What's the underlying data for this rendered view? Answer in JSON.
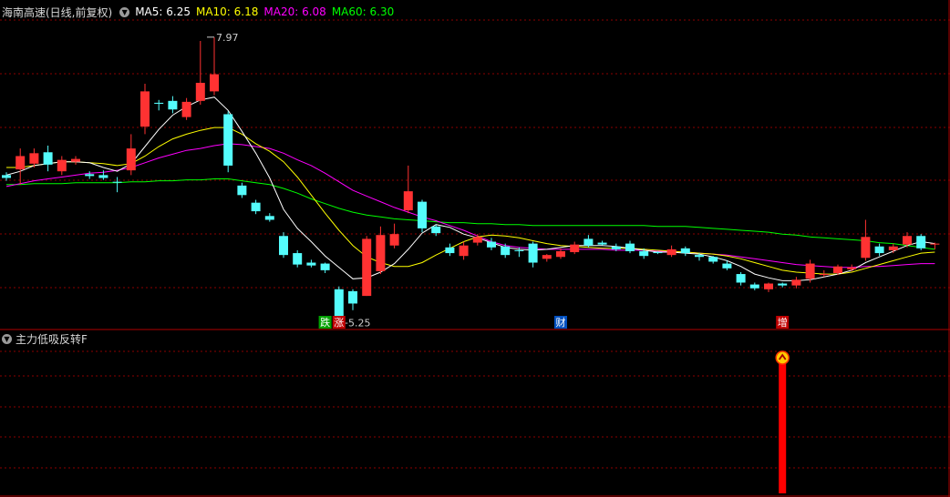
{
  "header": {
    "title": "海南高速(日线,前复权)",
    "indicators": [
      {
        "label": "MA5: 6.25",
        "color": "#ffffff"
      },
      {
        "label": "MA10: 6.18",
        "color": "#ffff00"
      },
      {
        "label": "MA20: 6.08",
        "color": "#ff00ff"
      },
      {
        "label": "MA60: 6.30",
        "color": "#00ff00"
      }
    ]
  },
  "sub_panel": {
    "title": "主力低吸反转F"
  },
  "colors": {
    "up": "#ff3232",
    "down": "#54fcfc",
    "grid": "#8b0000",
    "border": "#b00000"
  },
  "chart_data": {
    "type": "candlestick",
    "price_range": [
      5.05,
      8.15
    ],
    "high_label": "7.97",
    "low_label": "5.25",
    "candles": [
      [
        6.52,
        6.49,
        6.55,
        6.46
      ],
      [
        6.58,
        6.72,
        6.8,
        6.42
      ],
      [
        6.64,
        6.75,
        6.8,
        6.6
      ],
      [
        6.76,
        6.63,
        6.83,
        6.56
      ],
      [
        6.56,
        6.68,
        6.72,
        6.52
      ],
      [
        6.66,
        6.69,
        6.72,
        6.63
      ],
      [
        6.53,
        6.51,
        6.56,
        6.48
      ],
      [
        6.52,
        6.49,
        6.57,
        6.47
      ],
      [
        6.45,
        6.44,
        6.5,
        6.34
      ],
      [
        6.57,
        6.8,
        6.95,
        6.52
      ],
      [
        7.03,
        7.4,
        7.48,
        6.95
      ],
      [
        7.28,
        7.27,
        7.31,
        7.2
      ],
      [
        7.3,
        7.21,
        7.35,
        7.17
      ],
      [
        7.13,
        7.29,
        7.33,
        7.1
      ],
      [
        7.3,
        7.49,
        7.93,
        7.26
      ],
      [
        7.4,
        7.58,
        7.97,
        7.36
      ],
      [
        7.16,
        6.62,
        7.19,
        6.55
      ],
      [
        6.41,
        6.31,
        6.44,
        6.28
      ],
      [
        6.23,
        6.14,
        6.26,
        6.11
      ],
      [
        6.09,
        6.05,
        6.12,
        6.03
      ],
      [
        5.88,
        5.68,
        5.92,
        5.65
      ],
      [
        5.7,
        5.58,
        5.73,
        5.55
      ],
      [
        5.6,
        5.57,
        5.63,
        5.55
      ],
      [
        5.59,
        5.52,
        5.6,
        5.49
      ],
      [
        5.32,
        5.0,
        5.35,
        4.97
      ],
      [
        5.3,
        5.17,
        5.32,
        5.1
      ],
      [
        5.25,
        5.85,
        5.88,
        5.25
      ],
      [
        5.51,
        5.89,
        5.98,
        5.48
      ],
      [
        5.78,
        5.9,
        6.01,
        5.75
      ],
      [
        6.15,
        6.35,
        6.62,
        6.12
      ],
      [
        6.24,
        5.96,
        6.26,
        5.92
      ],
      [
        5.98,
        5.91,
        6.0,
        5.88
      ],
      [
        5.76,
        5.7,
        5.8,
        5.67
      ],
      [
        5.67,
        5.78,
        5.82,
        5.63
      ],
      [
        5.81,
        5.87,
        5.9,
        5.78
      ],
      [
        5.82,
        5.76,
        5.86,
        5.73
      ],
      [
        5.77,
        5.68,
        5.8,
        5.65
      ],
      [
        5.73,
        5.72,
        5.76,
        5.66
      ],
      [
        5.8,
        5.6,
        5.82,
        5.55
      ],
      [
        5.64,
        5.68,
        5.69,
        5.61
      ],
      [
        5.66,
        5.72,
        5.75,
        5.64
      ],
      [
        5.71,
        5.79,
        5.82,
        5.69
      ],
      [
        5.85,
        5.78,
        5.89,
        5.76
      ],
      [
        5.81,
        5.79,
        5.83,
        5.78
      ],
      [
        5.77,
        5.74,
        5.8,
        5.72
      ],
      [
        5.8,
        5.72,
        5.83,
        5.7
      ],
      [
        5.72,
        5.67,
        5.75,
        5.64
      ],
      [
        5.71,
        5.7,
        5.72,
        5.69
      ],
      [
        5.68,
        5.74,
        5.78,
        5.66
      ],
      [
        5.75,
        5.7,
        5.77,
        5.67
      ],
      [
        5.68,
        5.66,
        5.7,
        5.62
      ],
      [
        5.66,
        5.61,
        5.67,
        5.59
      ],
      [
        5.59,
        5.54,
        5.62,
        5.52
      ],
      [
        5.48,
        5.39,
        5.5,
        5.36
      ],
      [
        5.37,
        5.33,
        5.39,
        5.31
      ],
      [
        5.32,
        5.38,
        5.39,
        5.29
      ],
      [
        5.38,
        5.36,
        5.39,
        5.34
      ],
      [
        5.36,
        5.42,
        5.45,
        5.33
      ],
      [
        5.43,
        5.59,
        5.63,
        5.39
      ],
      [
        5.47,
        5.48,
        5.52,
        5.45
      ],
      [
        5.49,
        5.56,
        5.58,
        5.47
      ],
      [
        5.53,
        5.55,
        5.58,
        5.51
      ],
      [
        5.65,
        5.87,
        6.05,
        5.62
      ],
      [
        5.77,
        5.7,
        5.8,
        5.67
      ],
      [
        5.73,
        5.77,
        5.8,
        5.7
      ],
      [
        5.79,
        5.88,
        5.92,
        5.76
      ],
      [
        5.88,
        5.75,
        5.9,
        5.73
      ],
      [
        5.79,
        5.8,
        5.81,
        5.74
      ]
    ],
    "ma5": [
      6.52,
      6.56,
      6.62,
      6.64,
      6.66,
      6.66,
      6.65,
      6.6,
      6.56,
      6.64,
      6.82,
      7.0,
      7.15,
      7.24,
      7.31,
      7.34,
      7.2,
      6.98,
      6.75,
      6.49,
      6.16,
      5.96,
      5.82,
      5.67,
      5.55,
      5.43,
      5.44,
      5.5,
      5.59,
      5.74,
      5.91,
      6.0,
      5.97,
      5.9,
      5.86,
      5.81,
      5.76,
      5.74,
      5.73,
      5.74,
      5.76,
      5.78,
      5.78,
      5.78,
      5.77,
      5.75,
      5.73,
      5.71,
      5.71,
      5.7,
      5.69,
      5.66,
      5.62,
      5.56,
      5.48,
      5.44,
      5.41,
      5.41,
      5.42,
      5.45,
      5.48,
      5.52,
      5.6,
      5.66,
      5.72,
      5.78,
      5.82,
      5.8
    ],
    "ma10": [
      6.6,
      6.6,
      6.62,
      6.64,
      6.66,
      6.66,
      6.65,
      6.64,
      6.62,
      6.64,
      6.72,
      6.82,
      6.9,
      6.95,
      6.99,
      7.02,
      7.02,
      6.95,
      6.85,
      6.77,
      6.66,
      6.5,
      6.31,
      6.12,
      5.94,
      5.78,
      5.66,
      5.6,
      5.56,
      5.56,
      5.6,
      5.68,
      5.75,
      5.82,
      5.87,
      5.89,
      5.88,
      5.86,
      5.83,
      5.8,
      5.78,
      5.77,
      5.76,
      5.75,
      5.75,
      5.75,
      5.74,
      5.73,
      5.72,
      5.71,
      5.7,
      5.69,
      5.67,
      5.64,
      5.6,
      5.56,
      5.52,
      5.5,
      5.49,
      5.48,
      5.48,
      5.5,
      5.54,
      5.58,
      5.62,
      5.66,
      5.7,
      5.71
    ],
    "ma20": [
      6.4,
      6.43,
      6.46,
      6.48,
      6.5,
      6.52,
      6.54,
      6.55,
      6.57,
      6.6,
      6.65,
      6.7,
      6.74,
      6.78,
      6.8,
      6.83,
      6.85,
      6.84,
      6.82,
      6.8,
      6.75,
      6.68,
      6.62,
      6.54,
      6.45,
      6.36,
      6.3,
      6.24,
      6.18,
      6.13,
      6.08,
      6.04,
      5.99,
      5.94,
      5.88,
      5.82,
      5.78,
      5.76,
      5.75,
      5.74,
      5.74,
      5.74,
      5.74,
      5.74,
      5.73,
      5.73,
      5.73,
      5.72,
      5.72,
      5.71,
      5.7,
      5.69,
      5.68,
      5.66,
      5.64,
      5.62,
      5.6,
      5.58,
      5.57,
      5.56,
      5.55,
      5.55,
      5.56,
      5.56,
      5.57,
      5.58,
      5.59,
      5.59
    ],
    "ma60": [
      6.42,
      6.42,
      6.43,
      6.43,
      6.43,
      6.44,
      6.44,
      6.44,
      6.44,
      6.45,
      6.45,
      6.46,
      6.46,
      6.47,
      6.47,
      6.48,
      6.48,
      6.46,
      6.44,
      6.42,
      6.38,
      6.33,
      6.27,
      6.22,
      6.17,
      6.13,
      6.1,
      6.08,
      6.06,
      6.05,
      6.04,
      6.03,
      6.02,
      6.02,
      6.01,
      6.01,
      6.0,
      6.0,
      5.99,
      5.99,
      5.99,
      5.99,
      5.99,
      5.99,
      5.99,
      5.99,
      5.99,
      5.98,
      5.98,
      5.98,
      5.97,
      5.96,
      5.95,
      5.94,
      5.93,
      5.92,
      5.9,
      5.89,
      5.87,
      5.86,
      5.85,
      5.84,
      5.83,
      5.81,
      5.8,
      5.78,
      5.76,
      5.74
    ],
    "signals": [
      {
        "index": 23,
        "label": "跌",
        "bg": "#00a000"
      },
      {
        "index": 24,
        "label": "涨",
        "bg": "#c00000"
      },
      {
        "index": 40,
        "label": "财",
        "bg": "#0050c0"
      },
      {
        "index": 56,
        "label": "增",
        "bg": "#c00000"
      }
    ],
    "reversal_signal_index": 56
  }
}
